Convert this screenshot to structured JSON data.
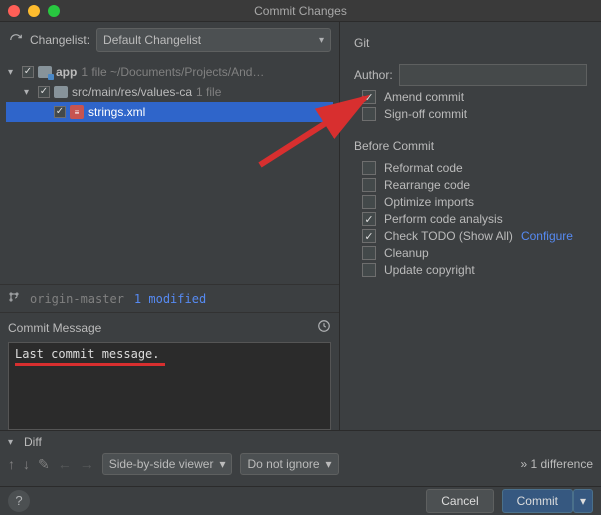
{
  "window": {
    "title": "Commit Changes"
  },
  "changelist": {
    "label": "Changelist:",
    "selected": "Default Changelist"
  },
  "tree": {
    "root": {
      "name": "app",
      "meta": "1 file  ~/Documents/Projects/And…"
    },
    "dir": {
      "name": "src/main/res/values-ca",
      "meta": "1 file"
    },
    "file": {
      "name": "strings.xml"
    }
  },
  "branch": {
    "name": "origin-master",
    "modified": "1 modified"
  },
  "commit_message": {
    "header": "Commit Message",
    "text": "Last commit message."
  },
  "git": {
    "title": "Git",
    "author_label": "Author:",
    "author_value": "",
    "amend": "Amend commit",
    "signoff": "Sign-off commit"
  },
  "before_commit": {
    "title": "Before Commit",
    "reformat": "Reformat code",
    "rearrange": "Rearrange code",
    "optimize": "Optimize imports",
    "analysis": "Perform code analysis",
    "todo": "Check TODO (Show All)",
    "configure": "Configure",
    "cleanup": "Cleanup",
    "copyright": "Update copyright"
  },
  "diff": {
    "label": "Diff",
    "viewer": "Side-by-side viewer",
    "whitespace": "Do not ignore",
    "count": "1 difference"
  },
  "footer": {
    "cancel": "Cancel",
    "commit": "Commit"
  }
}
